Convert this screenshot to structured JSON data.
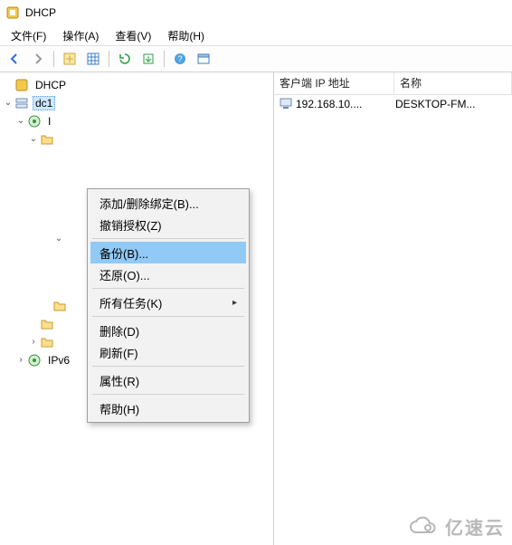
{
  "window": {
    "title": "DHCP"
  },
  "menubar": {
    "file": "文件(F)",
    "action": "操作(A)",
    "view": "查看(V)",
    "help": "帮助(H)"
  },
  "tree": {
    "root": "DHCP",
    "server": "dc1",
    "ipv4_child": "I",
    "ipv6": "IPv6"
  },
  "list": {
    "columns": {
      "ip": "客户端 IP 地址",
      "name": "名称"
    },
    "rows": [
      {
        "ip": "192.168.10....",
        "name": "DESKTOP-FM..."
      }
    ]
  },
  "context_menu": {
    "add_binding": "添加/删除绑定(B)...",
    "revoke_auth": "撤销授权(Z)",
    "backup": "备份(B)...",
    "restore": "还原(O)...",
    "all_tasks": "所有任务(K)",
    "delete": "删除(D)",
    "refresh": "刷新(F)",
    "properties": "属性(R)",
    "help": "帮助(H)"
  },
  "watermark": {
    "text": "亿速云"
  }
}
